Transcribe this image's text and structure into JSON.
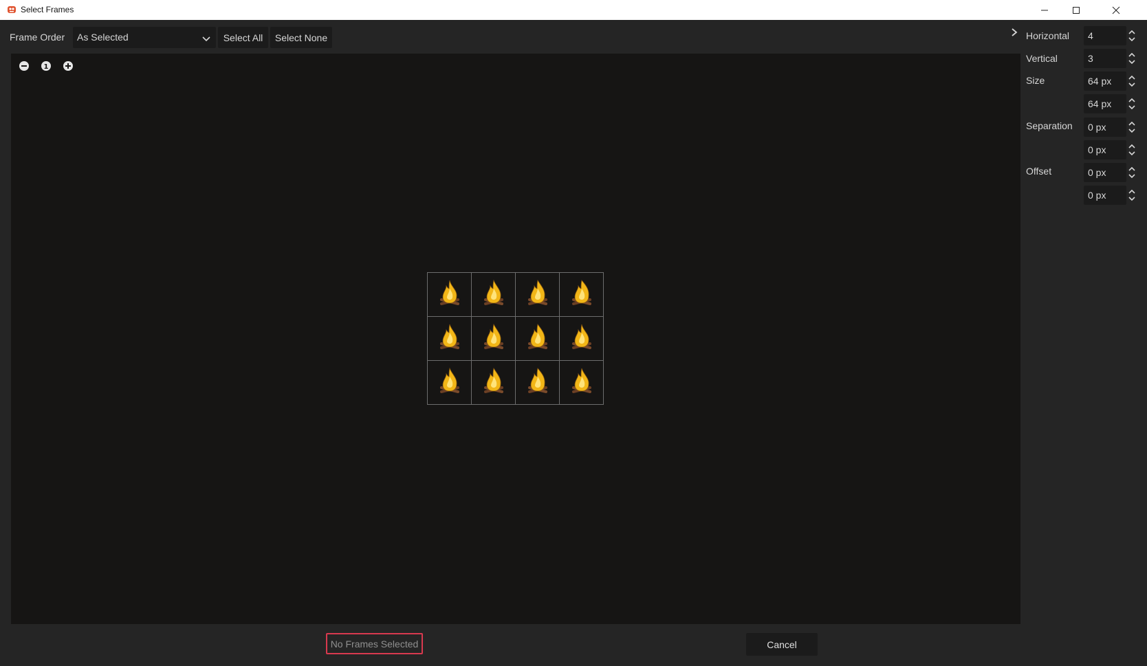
{
  "window": {
    "title": "Select Frames"
  },
  "toolbar": {
    "frame_order_label": "Frame Order",
    "frame_order_value": "As Selected",
    "select_all_label": "Select All",
    "select_none_label": "Select None",
    "collapse_icon": "chevron-right-icon"
  },
  "viewport": {
    "zoom_out_icon": "minus-circle-icon",
    "zoom_reset_label": "1",
    "zoom_in_icon": "plus-circle-icon",
    "grid": {
      "columns": 4,
      "rows": 3,
      "frame_icon": "campfire-icon"
    }
  },
  "settings": {
    "horizontal_label": "Horizontal",
    "horizontal_value": "4",
    "vertical_label": "Vertical",
    "vertical_value": "3",
    "size_label": "Size",
    "size_x": "64 px",
    "size_y": "64 px",
    "separation_label": "Separation",
    "separation_x": "0 px",
    "separation_y": "0 px",
    "offset_label": "Offset",
    "offset_x": "0 px",
    "offset_y": "0 px"
  },
  "footer": {
    "status_text": "No Frames Selected",
    "cancel_label": "Cancel"
  },
  "colors": {
    "background": "#252525",
    "viewport": "#161514",
    "status_border": "#d9394f",
    "flame": "#f2b617"
  }
}
